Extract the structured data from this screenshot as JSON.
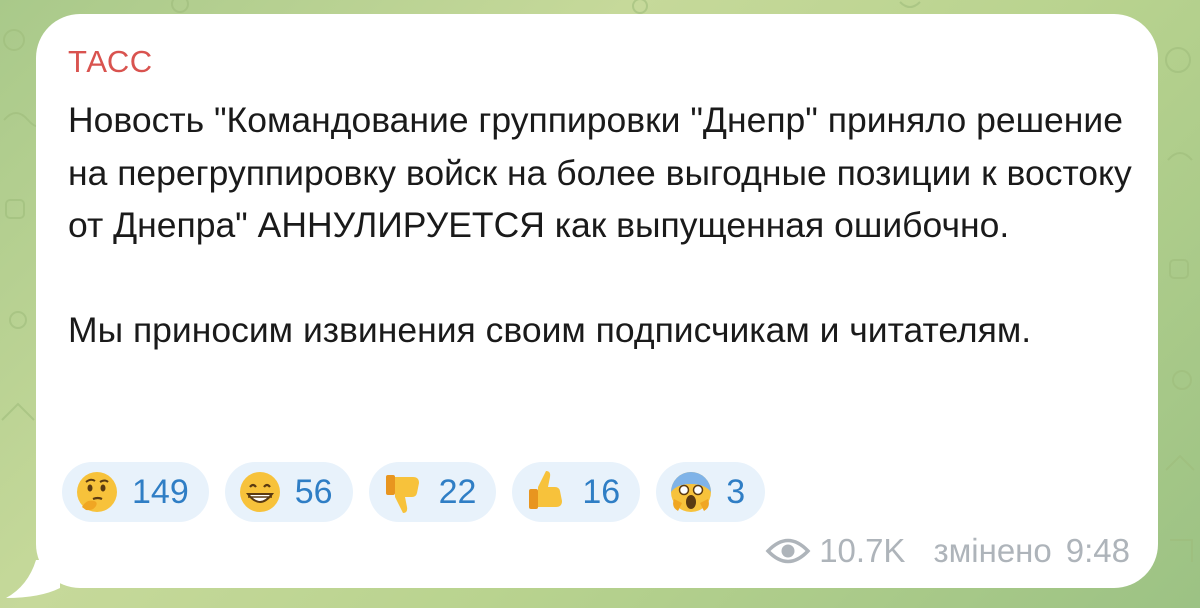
{
  "message": {
    "channel_name": "ТАСС",
    "paragraph1": "Новость \"Командование группировки \"Днепр\" приняло решение на перегруппировку войск на более выгодные позиции к востоку от Днепра\" АННУЛИРУЕТСЯ как выпущенная ошибочно.",
    "paragraph2": "Мы приносим извинения своим подписчикам и читателям."
  },
  "reactions": [
    {
      "emoji": "thinking-face-icon",
      "count": "149"
    },
    {
      "emoji": "grinning-face-icon",
      "count": "56"
    },
    {
      "emoji": "thumbs-down-icon",
      "count": "22"
    },
    {
      "emoji": "thumbs-up-icon",
      "count": "16"
    },
    {
      "emoji": "screaming-face-icon",
      "count": "3"
    }
  ],
  "meta": {
    "views": "10.7K",
    "edited_label": "змінено",
    "time": "9:48"
  },
  "colors": {
    "channel_name": "#d9534f",
    "reaction_bg": "#e8f2fb",
    "reaction_count": "#2f7ec5",
    "meta_text": "#aeb4ba",
    "background": "#b9d38f"
  }
}
